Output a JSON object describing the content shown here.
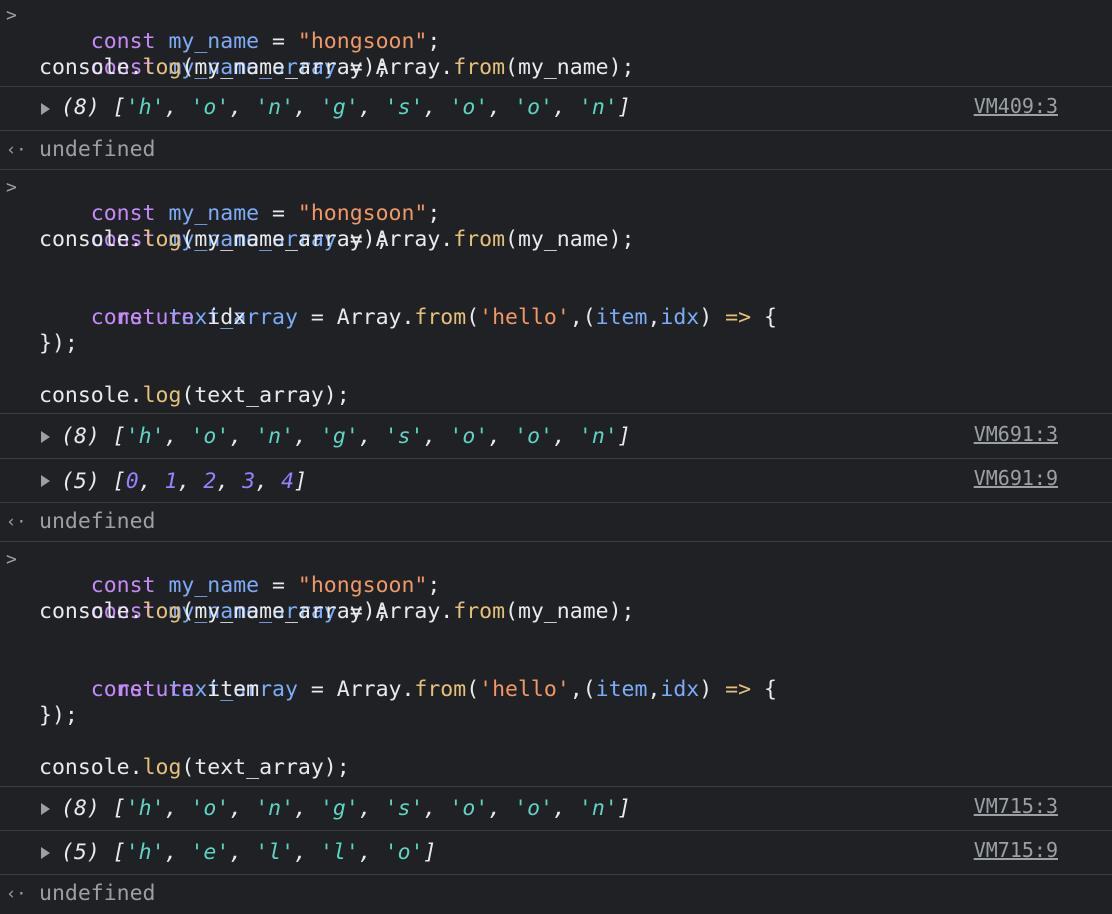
{
  "blocks": [
    {
      "prompt_icon": "chevron-right-icon",
      "code": [
        "const my_name = \"hongsoon\";",
        "const my_name_array = Array.from(my_name);",
        "console.log(my_name_array);"
      ],
      "outputs": [
        {
          "text": "(8) ['h', 'o', 'n', 'g', 's', 'o', 'o', 'n']",
          "source": "VM409:3"
        }
      ],
      "return_value": "undefined"
    },
    {
      "prompt_icon": "chevron-right-icon",
      "code": [
        "const my_name = \"hongsoon\";",
        "const my_name_array = Array.from(my_name);",
        "console.log(my_name_array);",
        "",
        "const text_array = Array.from('hello',(item,idx) => {",
        "      return idx",
        "});",
        "",
        "console.log(text_array);"
      ],
      "outputs": [
        {
          "text": "(8) ['h', 'o', 'n', 'g', 's', 'o', 'o', 'n']",
          "source": "VM691:3"
        },
        {
          "text": "(5) [0, 1, 2, 3, 4]",
          "source": "VM691:9"
        }
      ],
      "return_value": "undefined"
    },
    {
      "prompt_icon": "chevron-right-icon",
      "code": [
        "const my_name = \"hongsoon\";",
        "const my_name_array = Array.from(my_name);",
        "console.log(my_name_array);",
        "",
        "const text_array = Array.from('hello',(item,idx) => {",
        "      return item",
        "});",
        "",
        "console.log(text_array);"
      ],
      "outputs": [
        {
          "text": "(8) ['h', 'o', 'n', 'g', 's', 'o', 'o', 'n']",
          "source": "VM715:3"
        },
        {
          "text": "(5) ['h', 'e', 'l', 'l', 'o']",
          "source": "VM715:9"
        }
      ],
      "return_value": "undefined"
    }
  ],
  "icons": {
    "prompt": "chevron-right-icon",
    "return": "return-arrow-icon",
    "expand": "expand-triangle-icon"
  },
  "colors": {
    "background": "#202124",
    "keyword": "#c58af9",
    "variable": "#7cacf8",
    "string": "#f29766",
    "function": "#e5c07b",
    "array_string": "#5cd5c5",
    "array_number": "#9980ff",
    "muted": "#9aa0a6"
  }
}
